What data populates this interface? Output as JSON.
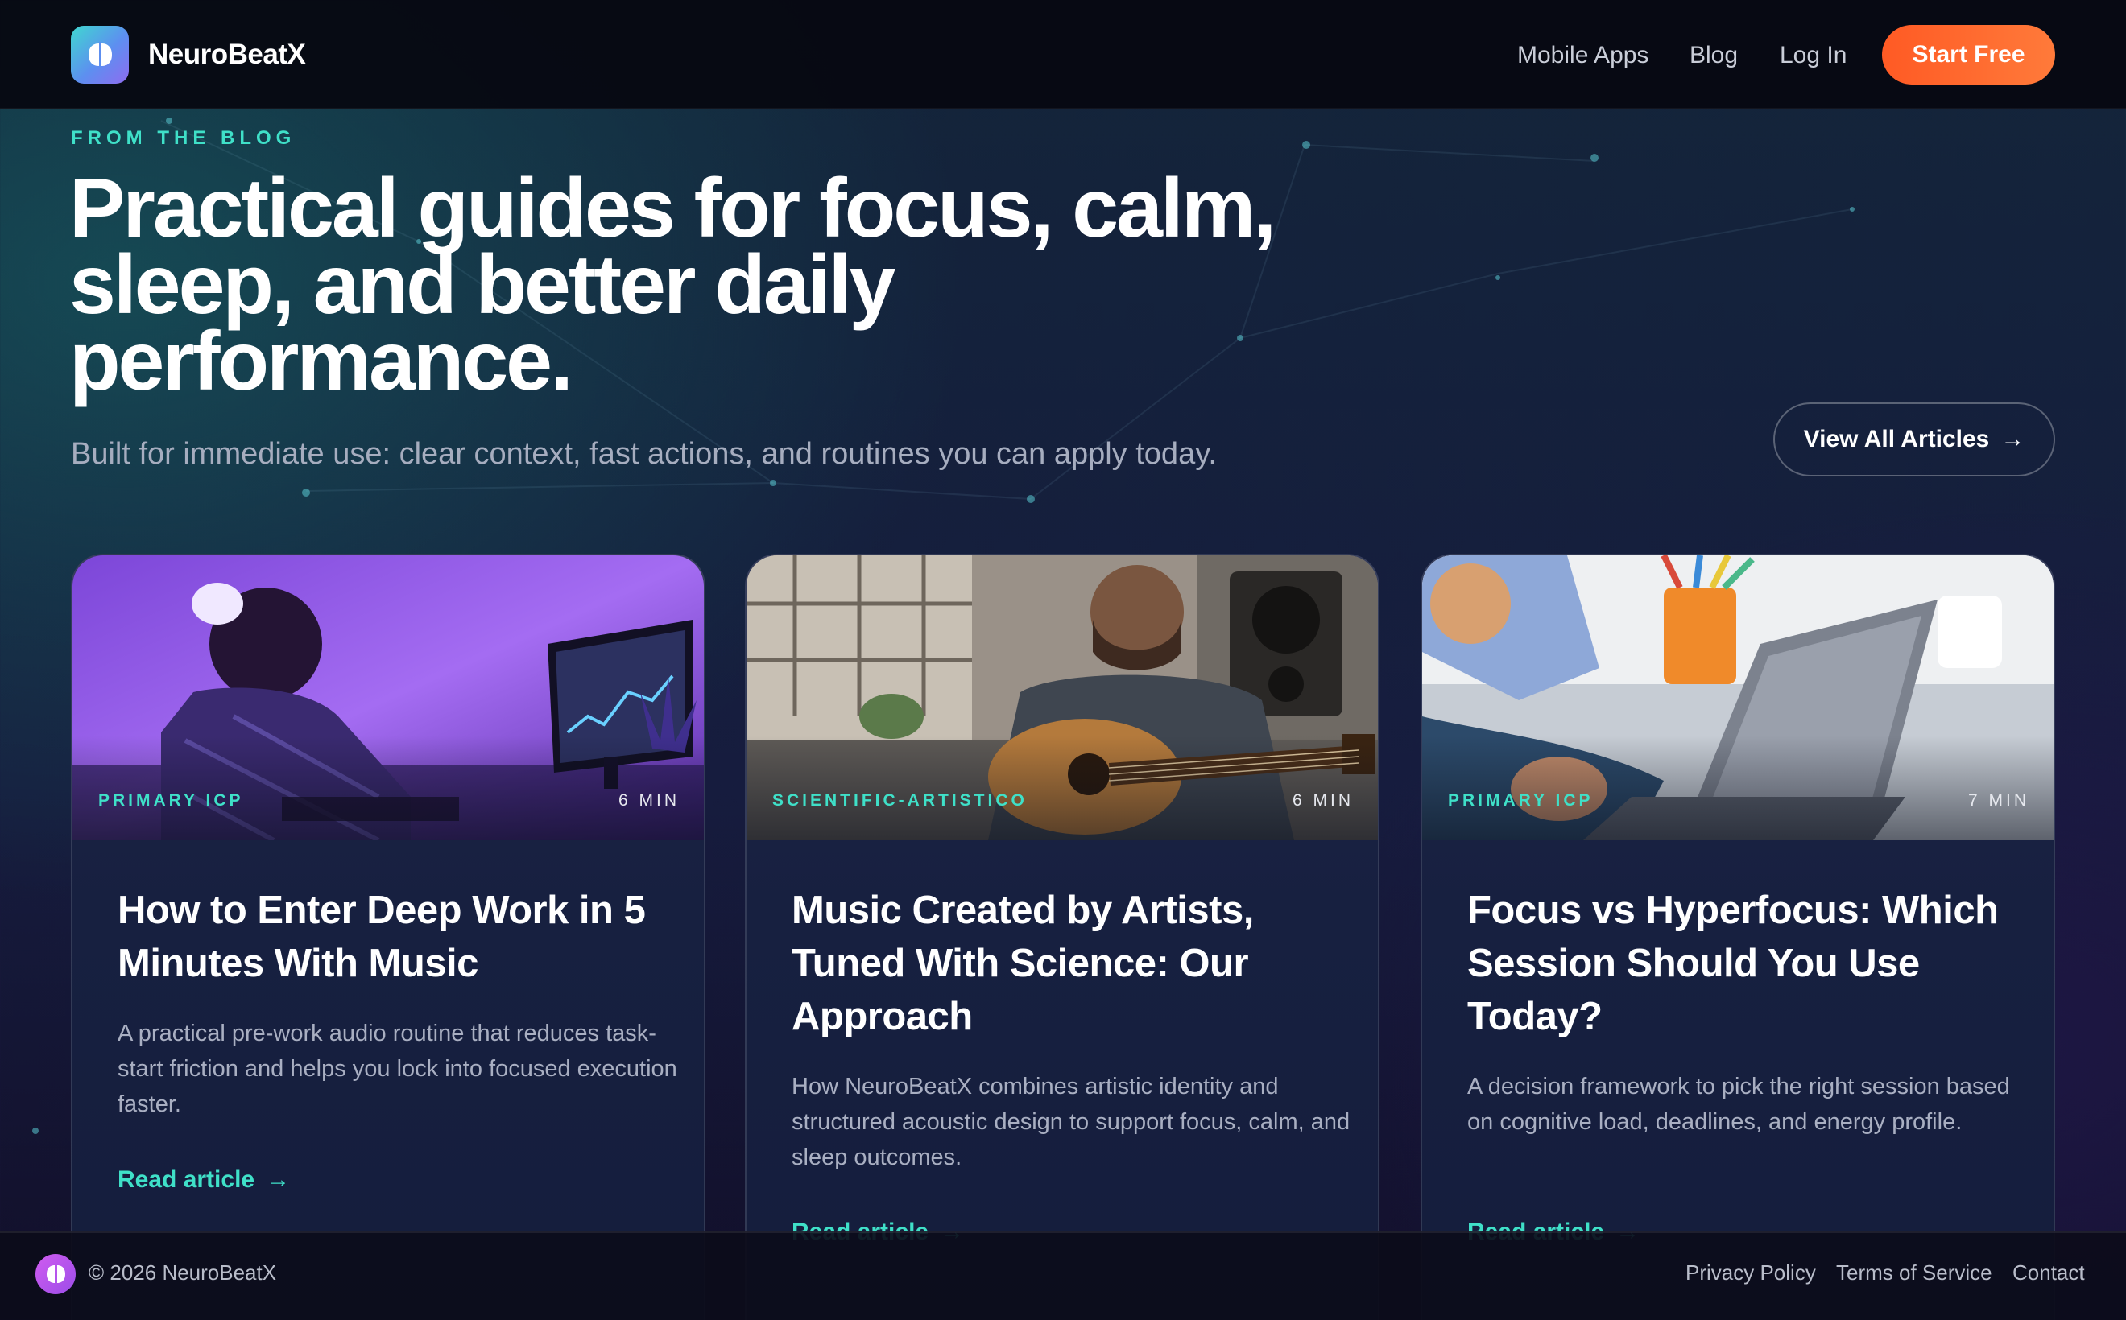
{
  "nav": {
    "brand": "NeuroBeatX",
    "links": [
      "Mobile Apps",
      "Blog",
      "Log In"
    ],
    "cta": "Start Free"
  },
  "hero": {
    "eyebrow": "FROM THE BLOG",
    "headline_lines": [
      "Practical guides for focus, calm,",
      "sleep, and better daily",
      "performance."
    ],
    "subhead": "Built for immediate use: clear context, fast actions, and routines you can apply today.",
    "view_all_label": "View All Articles",
    "view_all_arrow": "→"
  },
  "cards": [
    {
      "tag": "PRIMARY ICP",
      "read_time": "6 MIN",
      "title": "How to Enter Deep Work in 5 Minutes With Music",
      "description": "A practical pre-work audio routine that reduces task-start friction and helps you lock into focused execution faster.",
      "link": "Read article",
      "arrow": "→"
    },
    {
      "tag": "SCIENTIFIC-ARTISTICO",
      "read_time": "6 MIN",
      "title": "Music Created by Artists, Tuned With Science: Our Approach",
      "description": "How NeuroBeatX combines artistic identity and structured acoustic design to support focus, calm, and sleep outcomes.",
      "link": "Read article",
      "arrow": "→"
    },
    {
      "tag": "PRIMARY ICP",
      "read_time": "7 MIN",
      "title": "Focus vs Hyperfocus: Which Session Should You Use Today?",
      "description": "A decision framework to pick the right session based on cognitive load, deadlines, and energy profile.",
      "link": "Read article",
      "arrow": "→"
    }
  ],
  "footer": {
    "copyright": "© 2026 NeuroBeatX",
    "links": [
      "Privacy Policy",
      "Terms of Service",
      "Contact"
    ]
  },
  "colors": {
    "accent_teal": "#3fe0c8",
    "cta_orange": "#ff5a24",
    "nav_bg": "#06080f",
    "page_bg": "#161c3e"
  }
}
